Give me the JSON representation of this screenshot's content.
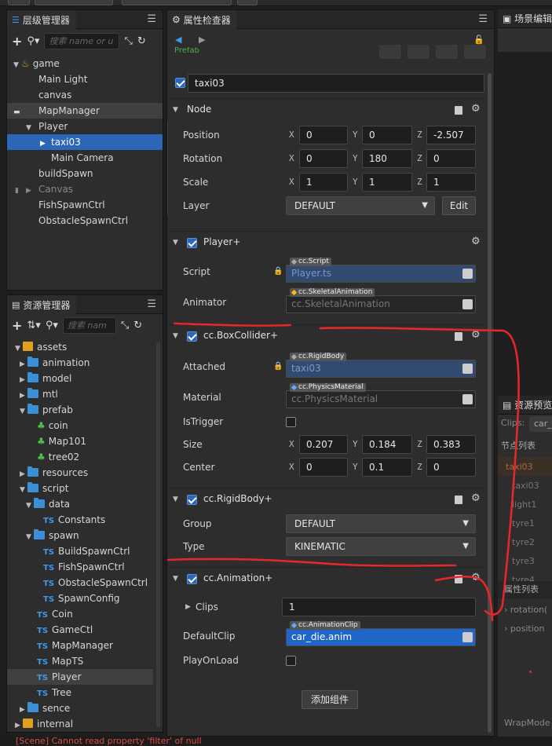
{
  "hierarchy": {
    "title": "层级管理器",
    "search_placeholder": "搜索 name or u",
    "items": [
      {
        "label": "game"
      },
      {
        "label": "Main Light"
      },
      {
        "label": "canvas"
      },
      {
        "label": "MapManager"
      },
      {
        "label": "Player"
      },
      {
        "label": "taxi03"
      },
      {
        "label": "Main Camera"
      },
      {
        "label": "buildSpawn"
      },
      {
        "label": "Canvas"
      },
      {
        "label": "FishSpawnCtrl"
      },
      {
        "label": "ObstacleSpawnCtrl"
      }
    ]
  },
  "assets": {
    "title": "资源管理器",
    "search_placeholder": "搜索 nam",
    "items": [
      {
        "label": "assets"
      },
      {
        "label": "animation"
      },
      {
        "label": "model"
      },
      {
        "label": "mtl"
      },
      {
        "label": "prefab"
      },
      {
        "label": "coin"
      },
      {
        "label": "Map101"
      },
      {
        "label": "tree02"
      },
      {
        "label": "resources"
      },
      {
        "label": "script"
      },
      {
        "label": "data"
      },
      {
        "label": "Constants"
      },
      {
        "label": "spawn"
      },
      {
        "label": "BuildSpawnCtrl"
      },
      {
        "label": "FishSpawnCtrl"
      },
      {
        "label": "ObstacleSpawnCtrl"
      },
      {
        "label": "SpawnConfig"
      },
      {
        "label": "Coin"
      },
      {
        "label": "GameCtl"
      },
      {
        "label": "MapManager"
      },
      {
        "label": "MapTS"
      },
      {
        "label": "Player"
      },
      {
        "label": "Tree"
      },
      {
        "label": "sence"
      },
      {
        "label": "internal"
      }
    ],
    "ts_badge": "TS"
  },
  "inspector": {
    "title": "属性检查器",
    "prefab_label": "Prefab",
    "node_name": "taxi03",
    "node": {
      "title": "Node",
      "position_label": "Position",
      "position": {
        "x": "0",
        "y": "0",
        "z": "-2.507"
      },
      "rotation_label": "Rotation",
      "rotation": {
        "x": "0",
        "y": "180",
        "z": "0"
      },
      "scale_label": "Scale",
      "scale": {
        "x": "1",
        "y": "1",
        "z": "1"
      },
      "layer_label": "Layer",
      "layer_value": "DEFAULT",
      "edit_label": "Edit",
      "axis_x": "X",
      "axis_y": "Y",
      "axis_z": "Z"
    },
    "player": {
      "title": "Player+",
      "script_label": "Script",
      "script_tag": "cc.Script",
      "script_value": "Player.ts",
      "animator_label": "Animator",
      "animator_tag": "cc.SkeletalAnimation",
      "animator_value": "cc.SkeletalAnimation"
    },
    "box": {
      "title": "cc.BoxCollider+",
      "attached_label": "Attached",
      "attached_tag": "cc.RigidBody",
      "attached_value": "taxi03",
      "material_label": "Material",
      "material_tag": "cc.PhysicsMaterial",
      "material_value": "cc.PhysicsMaterial",
      "istrigger_label": "IsTrigger",
      "size_label": "Size",
      "size": {
        "x": "0.207",
        "y": "0.184",
        "z": "0.383"
      },
      "center_label": "Center",
      "center": {
        "x": "0",
        "y": "0.1",
        "z": "0"
      }
    },
    "rigid": {
      "title": "cc.RigidBody+",
      "group_label": "Group",
      "group_value": "DEFAULT",
      "type_label": "Type",
      "type_value": "KINEMATIC"
    },
    "anim": {
      "title": "cc.Animation+",
      "clips_label": "Clips",
      "clips_value": "1",
      "defaultclip_label": "DefaultClip",
      "defaultclip_tag": "cc.AnimationClip",
      "defaultclip_value": "car_die.anim",
      "playonload_label": "PlayOnLoad"
    },
    "add_component": "添加组件"
  },
  "scene_panel": {
    "title": "场景编辑"
  },
  "preview_panel": {
    "title": "资源预览",
    "clips_label": "Clips:",
    "clips_value": "car_",
    "node_list_label": "节点列表",
    "nodes": [
      "taxi03",
      "taxi03",
      "light1",
      "tyre1",
      "tyre2",
      "tyre3",
      "tyre4"
    ],
    "prop_list_label": "属性列表",
    "props": [
      "rotation(",
      "position"
    ],
    "wrapmode": "WrapMode"
  },
  "status_message": "[Scene] Cannot read property 'filter' of null",
  "colors": {
    "selection": "#2b66b8",
    "annotation": "#e8272b",
    "error": "#e04848"
  }
}
